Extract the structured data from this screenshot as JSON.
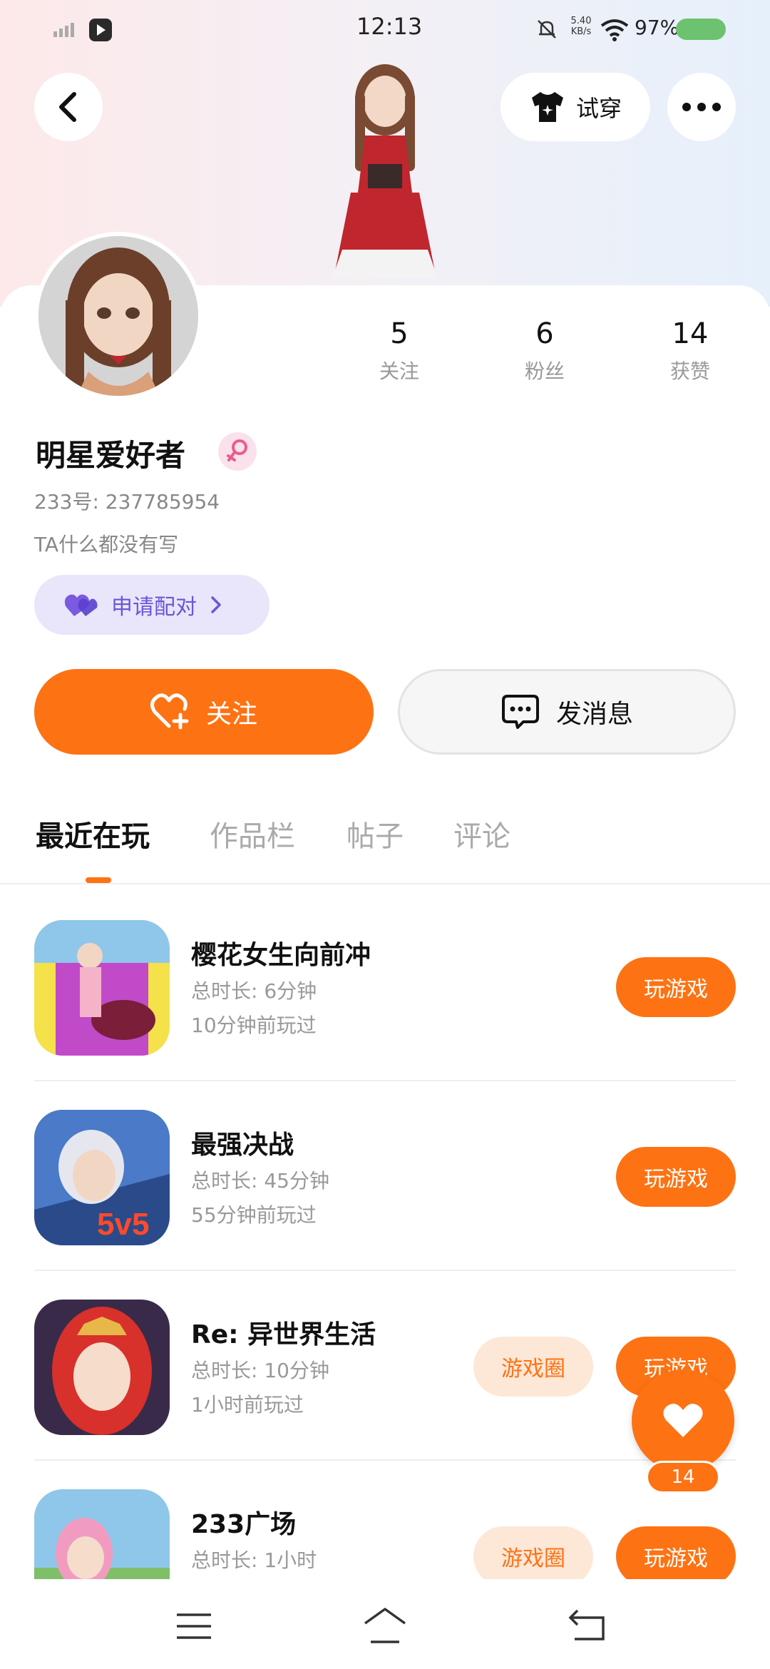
{
  "status_bar": {
    "time": "12:13",
    "net_speed": "5.40 KB/s",
    "battery": "97%"
  },
  "header": {
    "tryon_label": "试穿"
  },
  "profile": {
    "stats": [
      {
        "value": "5",
        "label": "关注"
      },
      {
        "value": "6",
        "label": "粉丝"
      },
      {
        "value": "14",
        "label": "获赞"
      }
    ],
    "username": "明星爱好者",
    "user_id": "233号: 237785954",
    "bio": "TA什么都没有写",
    "pair_label": "申请配对"
  },
  "actions": {
    "follow_label": "关注",
    "message_label": "发消息"
  },
  "tabs": [
    "最近在玩",
    "作品栏",
    "帖子",
    "评论"
  ],
  "games": [
    {
      "title": "樱花女生向前冲",
      "duration": "总时长: 6分钟",
      "last_played": "10分钟前玩过",
      "play_label": "玩游戏",
      "circle_label": ""
    },
    {
      "title": "最强决战",
      "duration": "总时长: 45分钟",
      "last_played": "55分钟前玩过",
      "play_label": "玩游戏",
      "circle_label": ""
    },
    {
      "title": "Re: 异世界生活",
      "duration": "总时长: 10分钟",
      "last_played": "1小时前玩过",
      "play_label": "玩游戏",
      "circle_label": "游戏圈"
    },
    {
      "title": "233广场",
      "duration": "总时长: 1小时",
      "last_played": "",
      "play_label": "玩游戏",
      "circle_label": "游戏圈"
    }
  ],
  "like_count": "14",
  "colors": {
    "accent": "#fd7213",
    "pair_bg": "#e9e6fb",
    "pair_text": "#6a56d8"
  }
}
